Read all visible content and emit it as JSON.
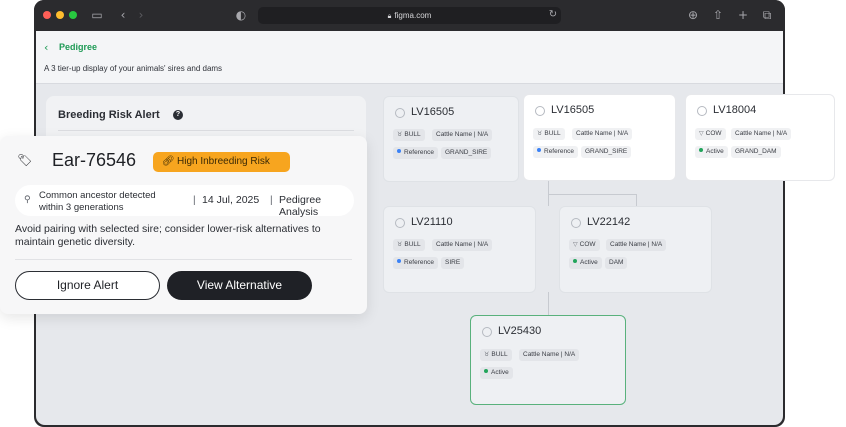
{
  "browser": {
    "url": "figma.com",
    "traffic_lights": {
      "close": "#fe5f57",
      "minimize": "#febc2e",
      "maximize": "#28c840"
    },
    "icons": [
      "sidebar-icon",
      "back-icon",
      "forward-icon",
      "shield-icon",
      "reload-icon",
      "download-icon",
      "share-icon",
      "new-tab-icon",
      "tabs-icon"
    ]
  },
  "page": {
    "breadcrumb": "Pedigree",
    "subtitle": "A 3 tier-up display of your animals' sires and dams"
  },
  "alert_panel": {
    "title": "Breeding Risk Alert"
  },
  "alert": {
    "animal_id": "Ear-76546",
    "risk_label": "High Inbreeding Risk",
    "info_line1": "Common ancestor detected",
    "info_line2": "within 3 generations",
    "separator": "|",
    "date": "14 Jul, 2025",
    "source": "Pedigree Analysis",
    "advice_line1": "Avoid pairing with selected sire; consider lower-risk alternatives to",
    "advice_line2": "maintain genetic diversity.",
    "ignore_label": "Ignore Alert",
    "view_label": "View Alternative",
    "badge_color": "#f7a51f"
  },
  "cards": [
    {
      "id": "LV16505",
      "sex_symbol": "♉",
      "sex": "BULL",
      "name": "Cattle Name | N/A",
      "status": "Reference",
      "status_color": "#3b82f6",
      "role": "GRAND_SIRE"
    },
    {
      "id": "LV16505",
      "sex_symbol": "♉",
      "sex": "BULL",
      "name": "Cattle Name | N/A",
      "status": "Reference",
      "status_color": "#3b82f6",
      "role": "GRAND_SIRE"
    },
    {
      "id": "LV18004",
      "sex_symbol": "▽",
      "sex": "COW",
      "name": "Cattle Name | N/A",
      "status": "Active",
      "status_color": "#22a55b",
      "role": "GRAND_DAM"
    },
    {
      "id": "LV21110",
      "sex_symbol": "♉",
      "sex": "BULL",
      "name": "Cattle Name | N/A",
      "status": "Reference",
      "status_color": "#3b82f6",
      "role": "SIRE"
    },
    {
      "id": "LV22142",
      "sex_symbol": "▽",
      "sex": "COW",
      "name": "Cattle Name | N/A",
      "status": "Active",
      "status_color": "#22a55b",
      "role": "DAM"
    },
    {
      "id": "LV25430",
      "sex_symbol": "♉",
      "sex": "BULL",
      "name": "Cattle Name | N/A",
      "status": "Active",
      "status_color": "#22a55b",
      "role": ""
    }
  ]
}
